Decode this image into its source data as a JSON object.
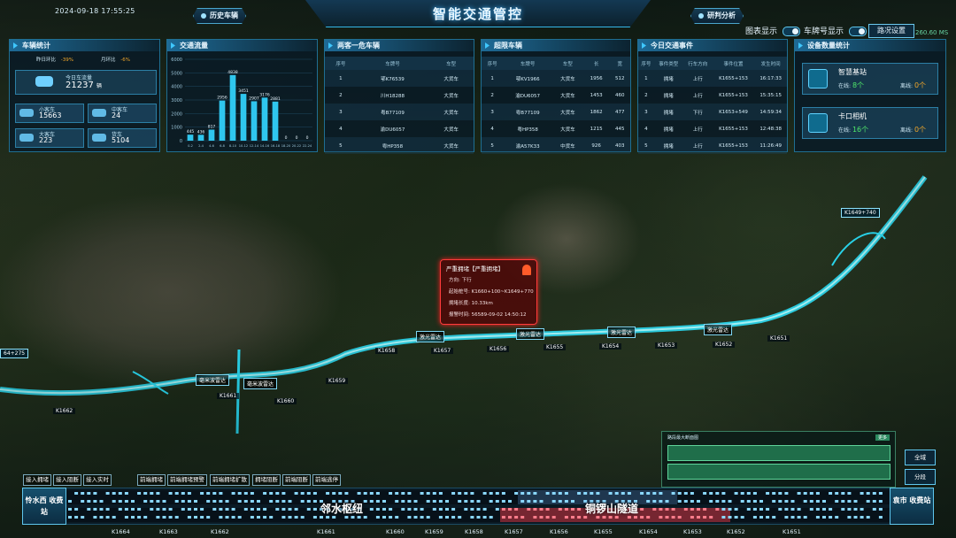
{
  "header": {
    "datetime": "2024-09-18 17:55:25",
    "title": "智能交通管控",
    "history_button": "历史车辆",
    "analysis_button": "研判分析",
    "chart_display_label": "图表显示",
    "plate_display_label": "车牌号显示",
    "road_settings_button": "路况设置",
    "latency": "260.60 MS"
  },
  "vehicle_stats": {
    "title": "车辆统计",
    "day_ratio_label": "昨日环比",
    "day_ratio_value": "-39%",
    "month_ratio_label": "月环比",
    "month_ratio_value": "-6%",
    "today_label": "今日车流量",
    "today_value": "21237",
    "unit": "辆",
    "items": [
      {
        "label": "小客车",
        "value": "15663"
      },
      {
        "label": "中客车",
        "value": "24"
      },
      {
        "label": "大客车",
        "value": "223"
      },
      {
        "label": "货车",
        "value": "5104"
      }
    ]
  },
  "traffic_flow": {
    "title": "交通流量",
    "chart_data": {
      "type": "bar",
      "ylim": [
        0,
        6000
      ],
      "ticks": [
        "6000",
        "5000",
        "4000",
        "3000",
        "2000",
        "1000",
        "0"
      ],
      "categories": [
        "0-2",
        "2-4",
        "4-6",
        "6-8",
        "8-10",
        "10-12",
        "12-14",
        "14-16",
        "16-18",
        "18-20",
        "20-22",
        "22-24"
      ],
      "values": [
        445,
        436,
        817,
        2956,
        4838,
        3451,
        2907,
        3176,
        2881,
        0,
        0,
        0
      ]
    }
  },
  "two_passenger": {
    "title": "两客一危车辆",
    "columns": [
      "序号",
      "车牌号",
      "车型"
    ],
    "rows": [
      [
        "1",
        "鄂K76539",
        "大货车"
      ],
      [
        "2",
        "川H18288",
        "大货车"
      ],
      [
        "3",
        "粤B77109",
        "大货车"
      ],
      [
        "4",
        "渝DU6057",
        "大货车"
      ],
      [
        "5",
        "粤HP358",
        "大货车"
      ]
    ]
  },
  "overspeed": {
    "title": "超限车辆",
    "columns": [
      "序号",
      "车牌号",
      "车型",
      "长",
      "宽"
    ],
    "rows": [
      [
        "1",
        "鄂KV1966",
        "大货车",
        "1956",
        "512"
      ],
      [
        "2",
        "渝DU6057",
        "大货车",
        "1453",
        "460"
      ],
      [
        "3",
        "粤B77109",
        "大货车",
        "1862",
        "477"
      ],
      [
        "4",
        "粤HP358",
        "大货车",
        "1215",
        "445"
      ],
      [
        "5",
        "渝A57K33",
        "中货车",
        "926",
        "403"
      ]
    ]
  },
  "events": {
    "title": "今日交通事件",
    "columns": [
      "序号",
      "事件类型",
      "行车方向",
      "事件位置",
      "发生时间"
    ],
    "rows": [
      [
        "1",
        "拥堵",
        "上行",
        "K1655+153",
        "16:17:33"
      ],
      [
        "2",
        "拥堵",
        "上行",
        "K1655+153",
        "15:35:15"
      ],
      [
        "3",
        "拥堵",
        "下行",
        "K1653+549",
        "14:59:34"
      ],
      [
        "4",
        "拥堵",
        "上行",
        "K1655+153",
        "12:48:38"
      ],
      [
        "5",
        "拥堵",
        "上行",
        "K1655+153",
        "11:26:49"
      ]
    ]
  },
  "devices": {
    "title": "设备数量统计",
    "items": [
      {
        "name": "智慧基站",
        "online_label": "在线:",
        "online": "8个",
        "offline_label": "离线:",
        "offline": "0个"
      },
      {
        "name": "卡口相机",
        "online_label": "在线:",
        "online": "16个",
        "offline_label": "离线:",
        "offline": "0个"
      }
    ]
  },
  "map": {
    "road_labels": [
      "激光雷达",
      "激光雷达",
      "激光雷达",
      "激光雷达",
      "毫米波雷达",
      "毫米波雷达"
    ],
    "km_labels": [
      "K1661",
      "K1660",
      "K1659",
      "K1658",
      "K1657",
      "K1656",
      "K1655",
      "K1654",
      "K1653",
      "K1652",
      "K1651",
      "K1662"
    ],
    "tag_right": "K1649+740",
    "tag_left": "64+275"
  },
  "alert": {
    "title": "严重拥堵【严重拥堵】",
    "direction": "方向: 下行",
    "start": "起始桩号: K1660+100~K1649+770",
    "length": "拥堵长度: 10.33km",
    "time": "报警时间: 56589-09-02 14:50:12"
  },
  "segments": [
    "接入拥堵",
    "接入阻断",
    "接入实时",
    "前端拥堵",
    "前端拥堵预警",
    "前端拥堵扩散",
    "拥堵阻断",
    "前端阻断",
    "前端逃停"
  ],
  "overview": {
    "title": "路段最大断面图",
    "button": "更多"
  },
  "side_buttons": [
    "全域",
    "分段"
  ],
  "strip": {
    "left_station": "怜水西 收费站",
    "right_station": "袁市 收费站",
    "hub": "邻水枢纽",
    "tunnel": "铜锣山隧道",
    "km": [
      "K1664",
      "K1663",
      "K1662",
      "K1661",
      "K1660",
      "K1659",
      "K1658",
      "K1657",
      "K1656",
      "K1655",
      "K1654",
      "K1653",
      "K1652",
      "K1651"
    ]
  }
}
